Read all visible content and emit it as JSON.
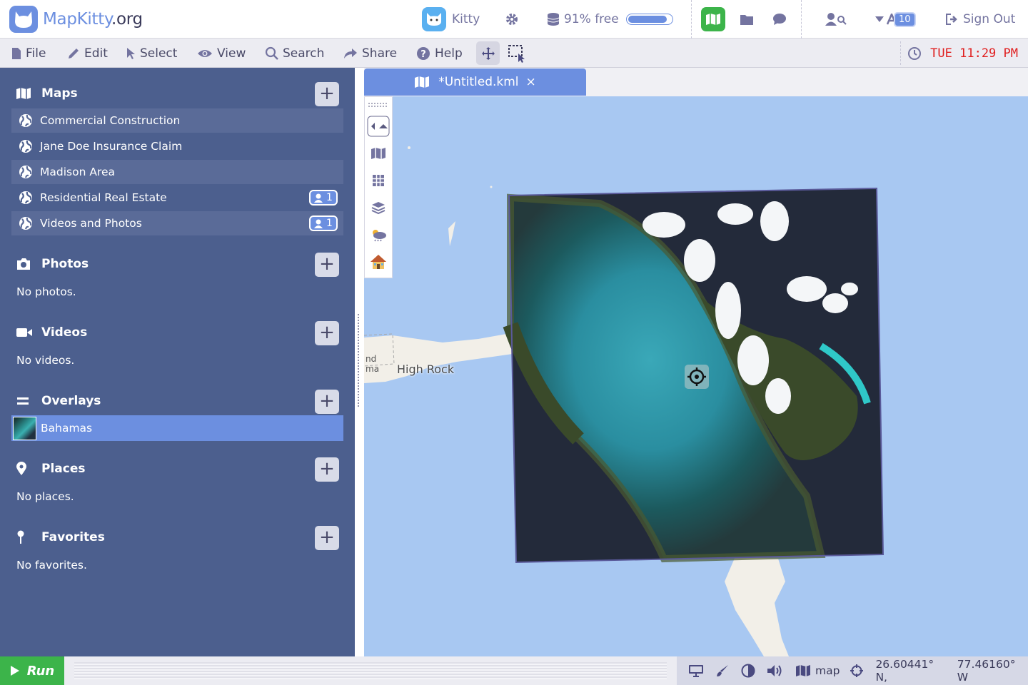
{
  "brand": {
    "name": "MapKitty",
    "tld": ".org"
  },
  "user": {
    "name": "Kitty"
  },
  "storage": {
    "label": "91% free",
    "free_fraction": 0.91
  },
  "header": {
    "notification_count": "10",
    "sign_out": "Sign Out"
  },
  "menu": {
    "file": "File",
    "edit": "Edit",
    "select": "Select",
    "view": "View",
    "search": "Search",
    "share": "Share",
    "help": "Help"
  },
  "clock": "TUE 11:29 PM",
  "sidebar": {
    "maps": {
      "title": "Maps",
      "items": [
        {
          "label": "Commercial Construction",
          "shared": ""
        },
        {
          "label": "Jane Doe Insurance Claim",
          "shared": ""
        },
        {
          "label": "Madison Area",
          "shared": ""
        },
        {
          "label": "Residential Real Estate",
          "shared": "1"
        },
        {
          "label": "Videos and Photos",
          "shared": "1"
        }
      ]
    },
    "photos": {
      "title": "Photos",
      "empty": "No photos."
    },
    "videos": {
      "title": "Videos",
      "empty": "No videos."
    },
    "overlays": {
      "title": "Overlays",
      "items": [
        {
          "label": "Bahamas"
        }
      ]
    },
    "places": {
      "title": "Places",
      "empty": "No places."
    },
    "favorites": {
      "title": "Favorites",
      "empty": "No favorites."
    }
  },
  "document": {
    "tab_title": "*Untitled.kml",
    "close": "×"
  },
  "map": {
    "label_high_rock": "High Rock",
    "label_partial": "nd\nma"
  },
  "status": {
    "run": "Run",
    "mode": "map",
    "lat": "26.60441° N,",
    "lon": "77.46160° W"
  },
  "colors": {
    "accent": "#6c8fe0",
    "sidebar": "#4c5f8e",
    "run": "#3cb44a",
    "clock": "#e02020",
    "water": "#a8c8f2"
  }
}
